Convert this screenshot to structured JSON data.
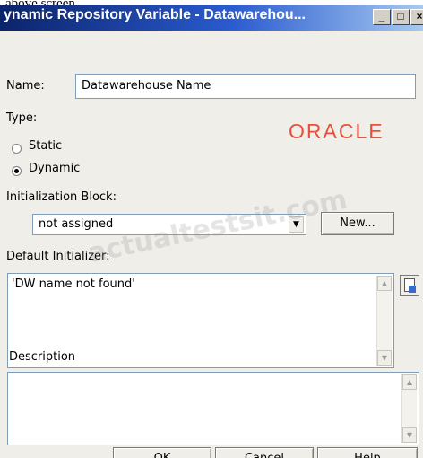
{
  "page_caption": "above screen.",
  "window": {
    "title": "ynamic Repository Variable - Datawarehou...",
    "minimize_glyph": "_",
    "maximize_glyph": "□",
    "close_glyph": "×"
  },
  "form": {
    "name_label": "Name:",
    "name_value": "Datawarehouse Name",
    "type_label": "Type:",
    "type_options": [
      {
        "label": "Static",
        "selected": false
      },
      {
        "label": "Dynamic",
        "selected": true
      }
    ],
    "logo_text": "ORACLE",
    "init_block_label": "Initialization Block:",
    "init_block_value": "not assigned",
    "new_button_label": "New...",
    "default_initializer_label": "Default Initializer:",
    "default_initializer_value": "'DW name not found'",
    "description_label": "Description",
    "description_value": ""
  },
  "watermark": "actualtestsit.com",
  "footer_buttons": {
    "ok": "OK",
    "cancel": "Cancel",
    "help": "Help"
  },
  "icons": {
    "dropdown_arrow": "triangle-down",
    "scroll_up": "triangle-up",
    "scroll_down": "triangle-down",
    "expression_builder": "expression-builder-icon"
  }
}
